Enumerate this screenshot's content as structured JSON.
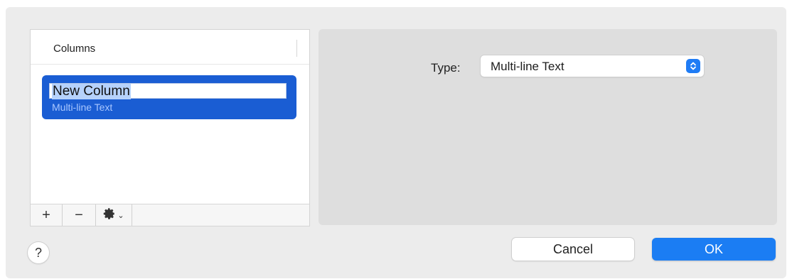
{
  "columns_list": {
    "header_label": "Columns",
    "rows": [
      {
        "name": "New Column",
        "type": "Multi-line Text"
      }
    ],
    "toolbar": {
      "add_label": "+",
      "remove_label": "−",
      "gear_icon": "gear-icon",
      "chevron": "⌄"
    }
  },
  "detail": {
    "type_label": "Type:",
    "type_value": "Multi-line Text"
  },
  "footer": {
    "help_label": "?",
    "cancel_label": "Cancel",
    "ok_label": "OK"
  },
  "colors": {
    "accent": "#1b7df3",
    "selection": "#1a5dd3"
  }
}
